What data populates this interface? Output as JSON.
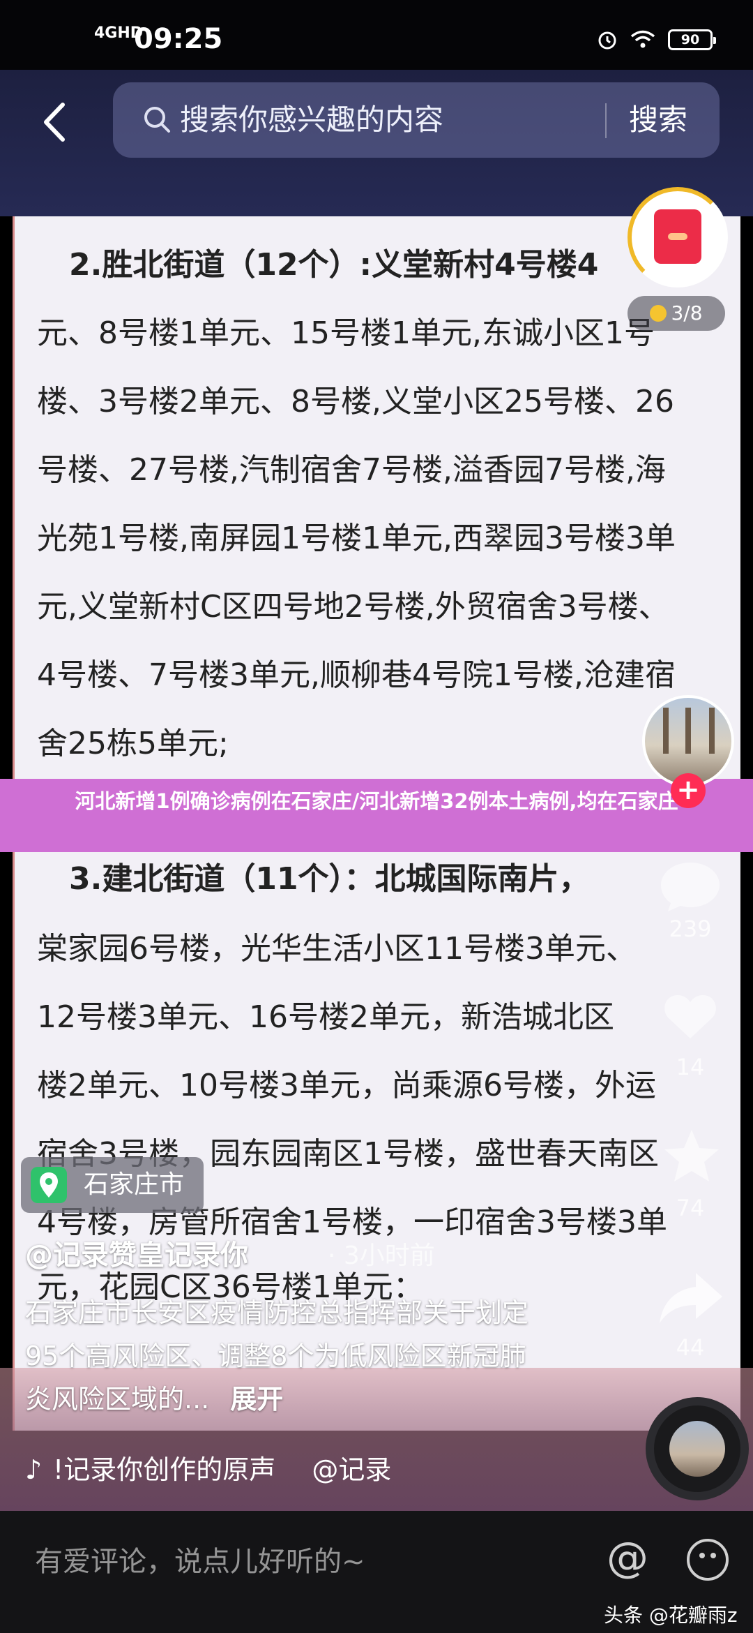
{
  "status_bar": {
    "network": "4GHD",
    "time": "09:25",
    "battery": "90"
  },
  "search": {
    "placeholder": "搜索你感兴趣的内容",
    "button_label": "搜索"
  },
  "document": {
    "lines": [
      "2.胜北街道（12个）:义堂新村4号楼4",
      "元、8号楼1单元、15号楼1单元,东诚小区1号",
      "楼、3号楼2单元、8号楼,义堂小区25号楼、26",
      "号楼、27号楼,汽制宿舍7号楼,溢香园7号楼,海",
      "光苑1号楼,南屏园1号楼1单元,西翠园3号楼3单",
      "元,义堂新村C区四号地2号楼,外贸宿舍3号楼、",
      "4号楼、7号楼3单元,顺柳巷4号院1号楼,沧建宿",
      "舍25栋5单元;",
      "3.建北街道（11个）：北城国际南片，",
      "棠家园6号楼，光华生活小区11号楼3单元、",
      "12号楼3单元、16号楼2单元，新浩城北区",
      "楼2单元、10号楼3单元，尚乘源6号楼，外运",
      "宿舍3号楼，园东园南区1号楼，盛世春天南区",
      "4号楼，房管所宿舍1号楼，一印宿舍3号楼3单",
      "元，花园C区36号楼1单元："
    ]
  },
  "banner": {
    "text": "河北新增1例确诊病例在石家庄/河北新增32例本土病例,均在石家庄"
  },
  "red_packet": {
    "progress": "3/8"
  },
  "rail": {
    "comment_count": "239",
    "collect_count": "14",
    "star_count": "74",
    "share_count": "44"
  },
  "location": {
    "label": "石家庄市"
  },
  "caption": {
    "author": "@记录赞皇记录你",
    "time": "· 3小时前",
    "text": "石家庄市长安区疫情防控总指挥部关于划定95个高风险区、调整8个为低风险区新冠肺炎风险区域的...",
    "expand": "展开"
  },
  "music": {
    "text": "!记录你创作的原声",
    "author": "@记录"
  },
  "comment_bar": {
    "placeholder": "有爱评论，说点儿好听的~"
  },
  "watermark": "头条 @花瓣雨z"
}
